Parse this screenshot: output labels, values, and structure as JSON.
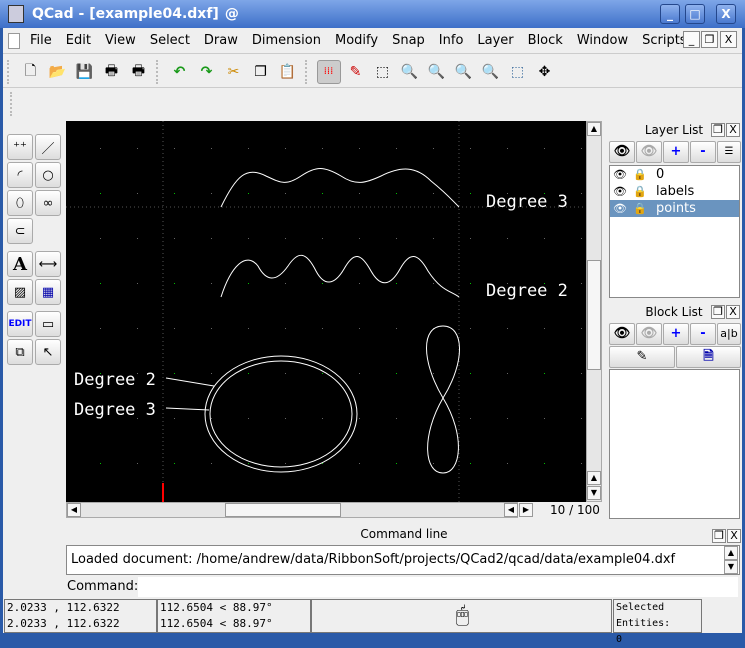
{
  "window": {
    "title": "QCad - [example04.dxf]",
    "buttons": [
      "_",
      "□",
      "X"
    ]
  },
  "menu": [
    "File",
    "Edit",
    "View",
    "Select",
    "Draw",
    "Dimension",
    "Modify",
    "Snap",
    "Info",
    "Layer",
    "Block",
    "Window",
    "Scripts"
  ],
  "toolbar": {
    "icons": [
      "new-icon",
      "open-icon",
      "save-icon",
      "print-icon",
      "print-preview-icon",
      "undo-icon",
      "redo-icon",
      "cut-icon",
      "copy-icon",
      "paste-icon",
      "grid-icon",
      "draft-icon",
      "redraw-icon",
      "zoom-in-icon",
      "zoom-out-icon",
      "zoom-auto-icon",
      "zoom-previous-icon",
      "zoom-window-icon",
      "zoom-pan-icon"
    ]
  },
  "tools": {
    "edit_label": "EDIT",
    "text_label": "A"
  },
  "drawing": {
    "labels": [
      "Degree 3",
      "Degree 2",
      "Degree 2",
      "Degree 3"
    ],
    "grid_color": "#00c000",
    "curve_color": "#ffffff"
  },
  "layer_list": {
    "title": "Layer List",
    "layers": [
      {
        "name": "0",
        "selected": false
      },
      {
        "name": "labels",
        "selected": false
      },
      {
        "name": "points",
        "selected": true
      }
    ],
    "buttons": [
      "+",
      "-"
    ]
  },
  "block_list": {
    "title": "Block List",
    "buttons": [
      "+",
      "-",
      "a|b"
    ]
  },
  "page_indicator": "10 / 100",
  "command_line": {
    "title": "Command line",
    "history": "Loaded document: /home/andrew/data/RibbonSoft/projects/QCad2/qcad/data/example04.dxf",
    "prompt": "Command:",
    "value": ""
  },
  "status": {
    "abs1": "2.0233 , 112.6322",
    "abs2": "2.0233 , 112.6322",
    "pol1": "112.6504 < 88.97°",
    "pol2": "112.6504 < 88.97°",
    "selected_label": "Selected Entities:",
    "selected_count": "0"
  },
  "accent": "#6a94bf"
}
